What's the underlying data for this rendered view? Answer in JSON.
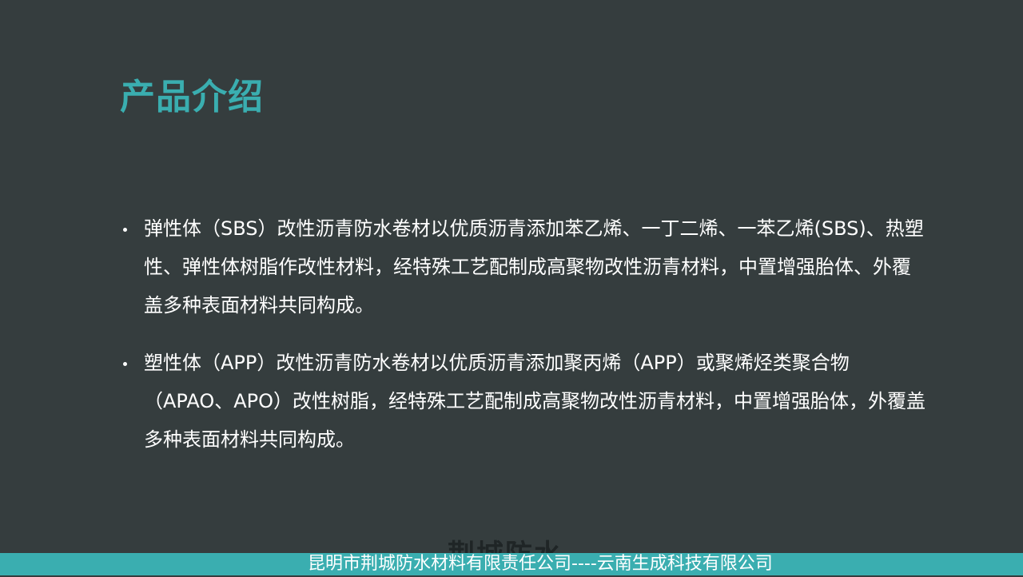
{
  "slide": {
    "title": "产品介绍",
    "bullets": [
      {
        "text": "弹性体（SBS）改性沥青防水卷材以优质沥青添加苯乙烯、一丁二烯、一苯乙烯(SBS)、热塑性、弹性体树脂作改性材料，经特殊工艺配制成高聚物改性沥青材料，中置增强胎体、外覆盖多种表面材料共同构成。"
      },
      {
        "text": "塑性体（APP）改性沥青防水卷材以优质沥青添加聚丙烯（APP）或聚烯烃类聚合物（APAO、APO）改性树脂，经特殊工艺配制成高聚物改性沥青材料，中置增强胎体，外覆盖多种表面材料共同构成。"
      }
    ],
    "watermark": "荆城防水",
    "footer": "昆明市荆城防水材料有限责任公司----云南生成科技有限公司"
  },
  "colors": {
    "background": "#353d3e",
    "accent": "#3aaeb0",
    "text": "#ffffff"
  }
}
